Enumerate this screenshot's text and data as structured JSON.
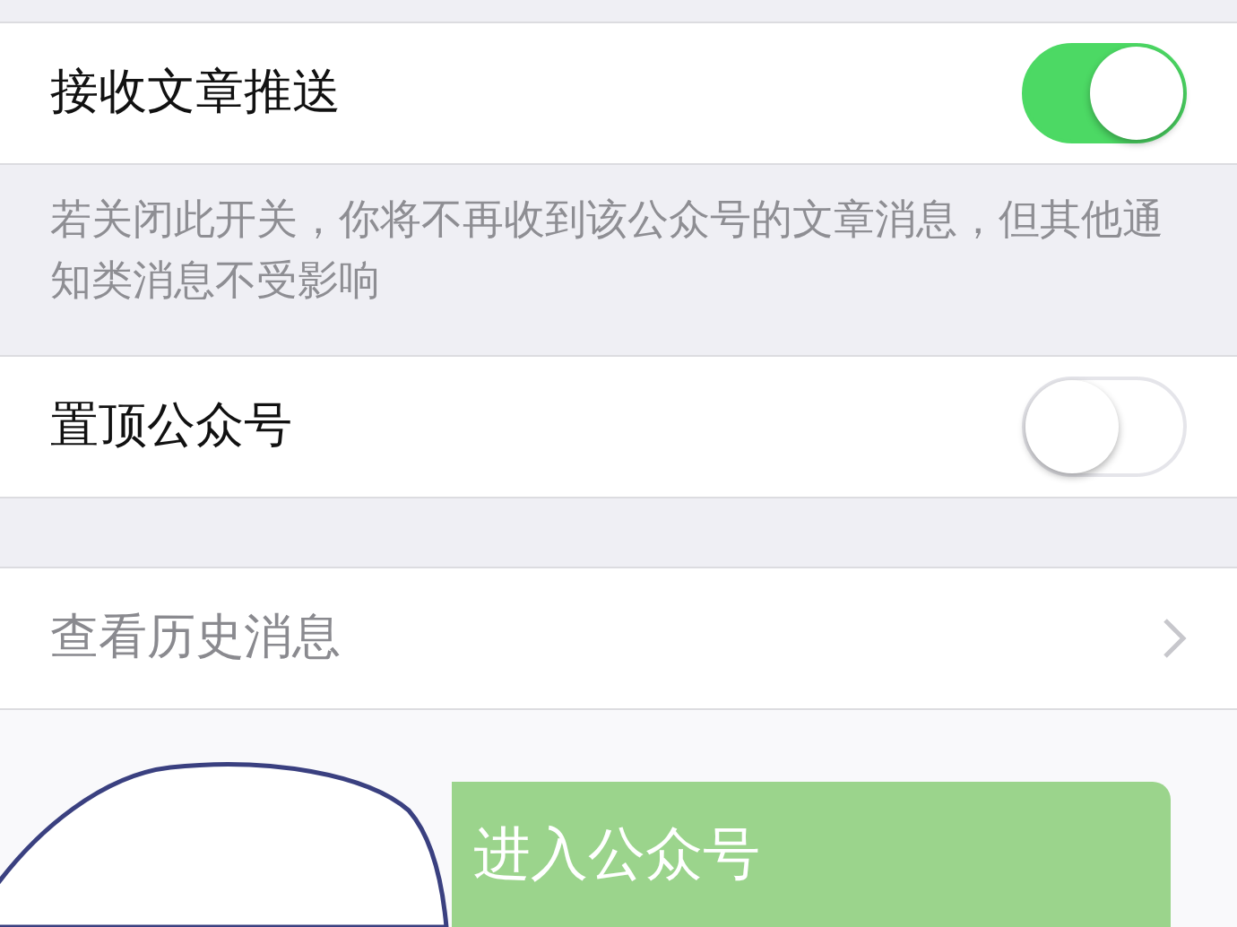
{
  "settings": [
    {
      "kind": "toggle",
      "label": "接收文章推送",
      "on": true,
      "note": "若关闭此开关，你将不再收到该公众号的文章消息，但其他通知类消息不受影响"
    },
    {
      "kind": "toggle",
      "label": "置顶公众号",
      "on": false
    },
    {
      "kind": "link",
      "label": "查看历史消息",
      "disabled": true
    }
  ],
  "button": {
    "label": "进入公众号",
    "disabled": true
  }
}
